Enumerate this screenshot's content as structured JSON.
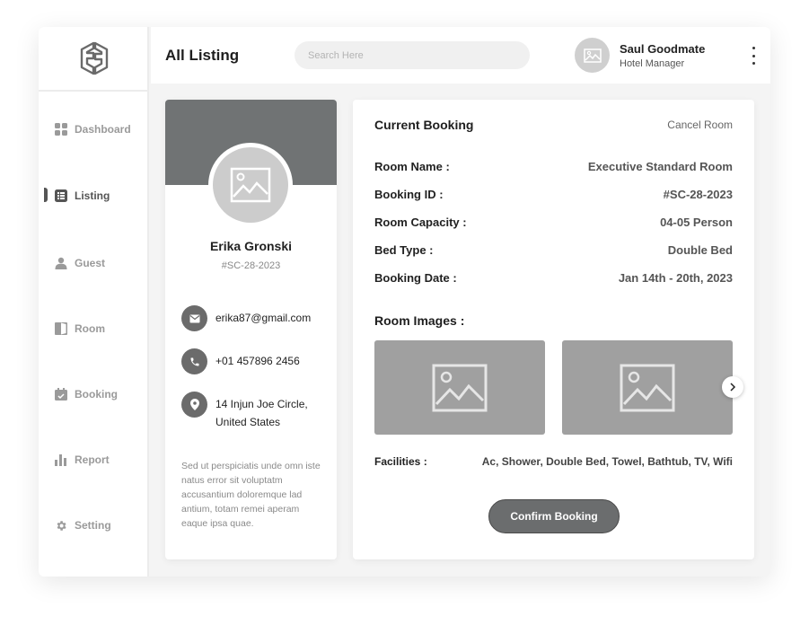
{
  "sidebar": {
    "items": [
      {
        "label": "Dashboard",
        "icon": "grid-icon"
      },
      {
        "label": "Listing",
        "icon": "list-icon",
        "active": true
      },
      {
        "label": "Guest",
        "icon": "user-icon"
      },
      {
        "label": "Room",
        "icon": "door-icon"
      },
      {
        "label": "Booking",
        "icon": "calendar-icon"
      },
      {
        "label": "Report",
        "icon": "bar-chart-icon"
      },
      {
        "label": "Setting",
        "icon": "gear-icon"
      }
    ]
  },
  "header": {
    "title": "All Listing",
    "search_placeholder": "Search Here",
    "user_name": "Saul Goodmate",
    "user_role": "Hotel Manager"
  },
  "profile": {
    "name": "Erika Gronski",
    "id": "#SC-28-2023",
    "email": "erika87@gmail.com",
    "phone": "+01 457896 2456",
    "address_line1": "14 Injun Joe Circle,",
    "address_line2": "United States",
    "description": "Sed ut perspiciatis unde omn iste natus error sit voluptatm accusantium doloremque lad antium, totam remei aperam eaque ipsa quae."
  },
  "booking": {
    "title": "Current Booking",
    "cancel_label": "Cancel Room",
    "fields": [
      {
        "label": "Room Name :",
        "value": "Executive Standard Room"
      },
      {
        "label": "Booking ID :",
        "value": "#SC-28-2023"
      },
      {
        "label": "Room Capacity :",
        "value": "04-05 Person"
      },
      {
        "label": "Bed Type :",
        "value": "Double Bed"
      },
      {
        "label": "Booking Date :",
        "value": "Jan 14th - 20th, 2023"
      }
    ],
    "images_title": "Room Images :",
    "facilities_label": "Facilities :",
    "facilities_value": "Ac, Shower, Double Bed, Towel, Bathtub, TV, Wifi",
    "confirm_label": "Confirm Booking"
  },
  "colors": {
    "accent": "#6b6d6e",
    "cover": "#707374",
    "placeholder": "#a0a0a0"
  }
}
